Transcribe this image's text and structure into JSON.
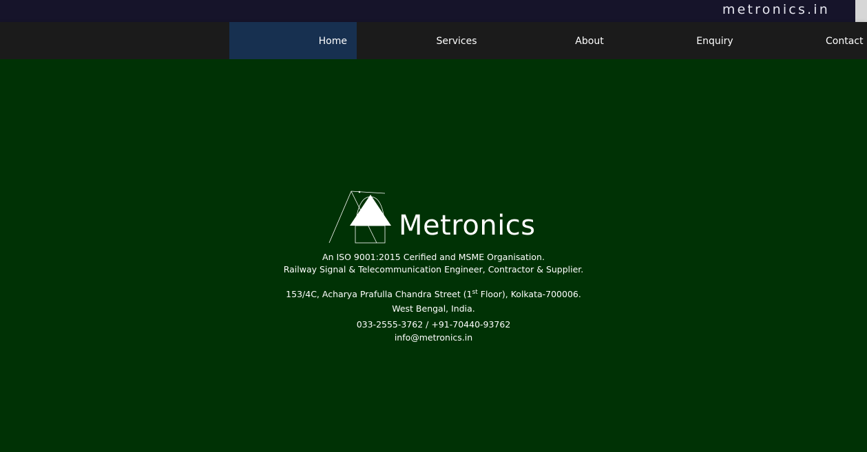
{
  "header": {
    "site_name": "metronics.in"
  },
  "nav": {
    "items": [
      {
        "label": "Home",
        "active": true
      },
      {
        "label": "Services",
        "active": false
      },
      {
        "label": "About",
        "active": false
      },
      {
        "label": "Enquiry",
        "active": false
      },
      {
        "label": "Contact",
        "active": false
      }
    ]
  },
  "hero": {
    "brand_name": "Metronics",
    "tagline_1": "An ISO 9001:2015 Cerified and MSME Organisation.",
    "tagline_2": "Railway Signal & Telecommunication Engineer, Contractor & Supplier.",
    "address_1_pre": "153/4C, Acharya Prafulla Chandra Street (1",
    "address_1_sup": "st",
    "address_1_post": " Floor), Kolkata-700006.",
    "address_2": "West Bengal, India.",
    "phone": "033-2555-3762 / +91-70440-93762",
    "email": "info@metronics.in"
  },
  "colors": {
    "topbar": "#16142a",
    "navbar": "#1b1b1b",
    "nav_active": "#173050",
    "hero_bg": "#003205",
    "text": "#ffffff"
  },
  "icons": {
    "logo": "metronics-triangle-logo"
  }
}
